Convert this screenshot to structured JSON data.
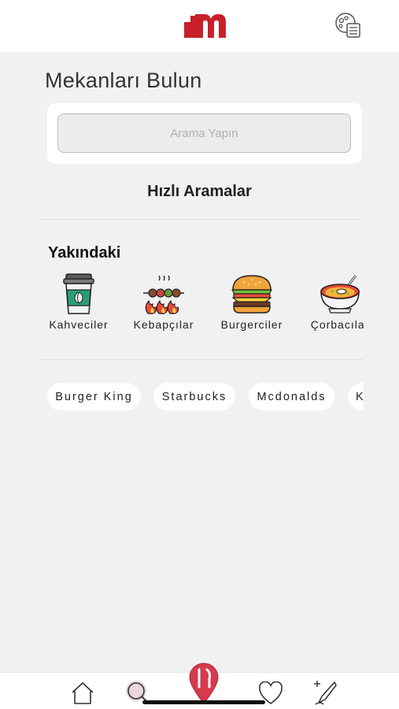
{
  "header": {
    "logo_icon": "m-logo",
    "menu_icon": "menu-list-icon"
  },
  "page_title": "Mekanları Bulun",
  "search": {
    "placeholder": "Arama Yapın",
    "value": ""
  },
  "quick_search_title": "Hızlı Aramalar",
  "nearby": {
    "title": "Yakındaki",
    "categories": [
      {
        "label": "Kahveciler",
        "icon": "coffee-cup-icon"
      },
      {
        "label": "Kebapçılar",
        "icon": "kebab-icon"
      },
      {
        "label": "Burgerciler",
        "icon": "burger-icon"
      },
      {
        "label": "Çorbacılar",
        "icon": "soup-icon"
      }
    ]
  },
  "chips": [
    "Burger King",
    "Starbucks",
    "Mcdonalds",
    "KFC"
  ],
  "bottom_nav": [
    {
      "icon": "home-icon"
    },
    {
      "icon": "search-icon"
    },
    {
      "icon": "location-pin-icon"
    },
    {
      "icon": "heart-icon"
    },
    {
      "icon": "add-review-icon"
    }
  ],
  "colors": {
    "brand": "#c8202a",
    "background": "#f1f1f1",
    "card": "#ffffff"
  }
}
